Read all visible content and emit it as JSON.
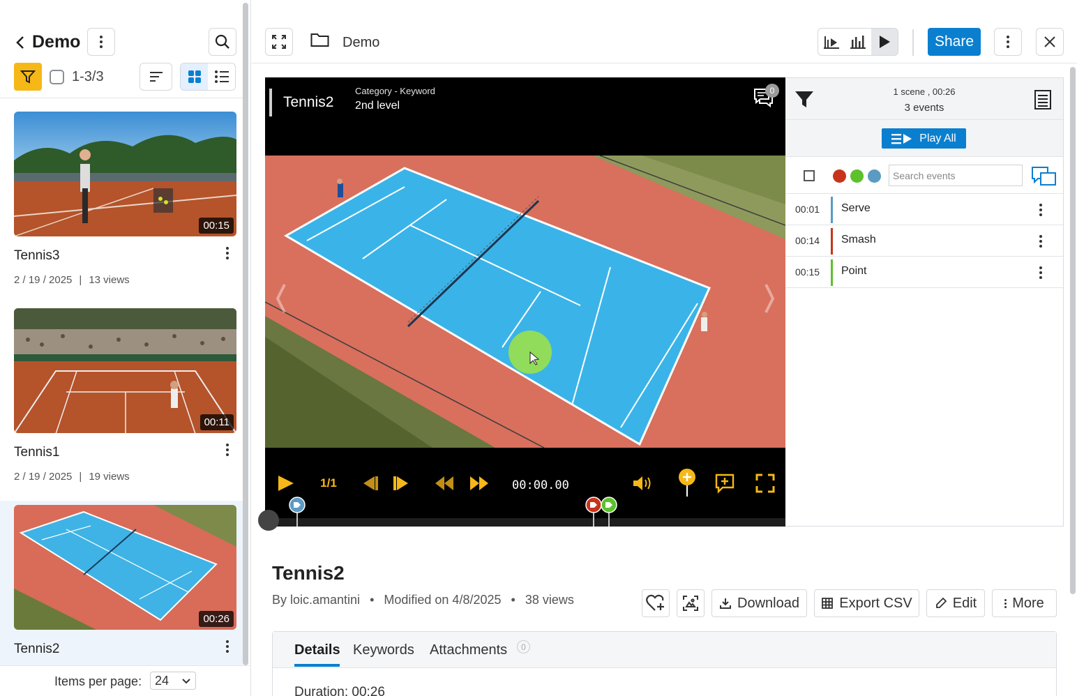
{
  "sidebar": {
    "title": "Demo",
    "selection_count": "1-3/3",
    "items_per_page_label": "Items per page:",
    "items_per_page_value": "24",
    "cards": [
      {
        "title": "Tennis3",
        "date": "2 / 19 / 2025",
        "views": "13 views",
        "duration": "00:15"
      },
      {
        "title": "Tennis1",
        "date": "2 / 19 / 2025",
        "views": "19 views",
        "duration": "00:11"
      },
      {
        "title": "Tennis2",
        "date": "",
        "views": "",
        "duration": "00:26"
      }
    ]
  },
  "topbar": {
    "breadcrumb": "Demo",
    "share_label": "Share"
  },
  "player": {
    "title": "Tennis2",
    "category": "Category - Keyword",
    "level": "2nd level",
    "comment_count": "0",
    "timecode": "00:00.00",
    "speed": "1/1"
  },
  "events": {
    "scene_info": "1 scene , 00:26",
    "event_count": "3 events",
    "play_all_label": "Play All",
    "search_placeholder": "Search events",
    "colors": [
      "#c8341b",
      "#5cc12c",
      "#5a9bc4"
    ],
    "rows": [
      {
        "time": "00:01",
        "name": "Serve",
        "color": "#5a9bc4"
      },
      {
        "time": "00:14",
        "name": "Smash",
        "color": "#c8341b"
      },
      {
        "time": "00:15",
        "name": "Point",
        "color": "#5cc12c"
      }
    ]
  },
  "details": {
    "title": "Tennis2",
    "author": "By loic.amantini",
    "modified": "Modified on 4/8/2025",
    "views": "38 views",
    "download_label": "Download",
    "export_label": "Export CSV",
    "edit_label": "Edit",
    "more_label": "More",
    "tabs": [
      "Details",
      "Keywords",
      "Attachments"
    ],
    "attachments_count": "0",
    "duration_label": "Duration:",
    "duration_value": "00:26"
  }
}
